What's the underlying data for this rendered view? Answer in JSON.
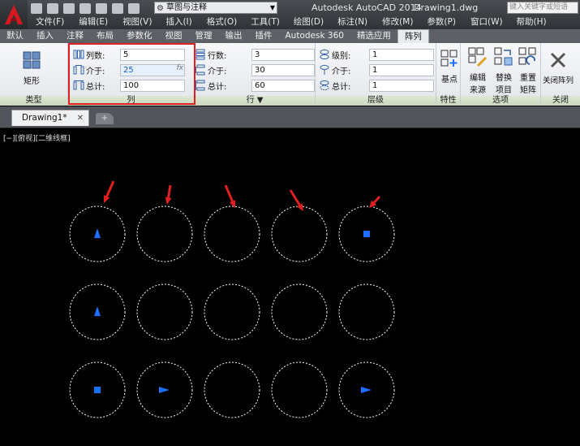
{
  "titlebar": {
    "workspace": "草图与注释",
    "app_title": "Autodesk AutoCAD 2014",
    "doc_title": "Drawing1.dwg",
    "search_placeholder": "键入关键字或短语"
  },
  "menu": [
    "文件(F)",
    "编辑(E)",
    "视图(V)",
    "插入(I)",
    "格式(O)",
    "工具(T)",
    "绘图(D)",
    "标注(N)",
    "修改(M)",
    "参数(P)",
    "窗口(W)",
    "帮助(H)"
  ],
  "ribbon_tabs": [
    "默认",
    "插入",
    "注释",
    "布局",
    "参数化",
    "视图",
    "管理",
    "输出",
    "插件",
    "Autodesk 360",
    "精选应用",
    "阵列"
  ],
  "active_tab": "阵列",
  "ribbon": {
    "type_panel": {
      "button": "矩形",
      "title": "类型"
    },
    "columns_panel": {
      "title": "列",
      "rows": [
        {
          "label": "列数:",
          "value": "5"
        },
        {
          "label": "介于:",
          "value": "25"
        },
        {
          "label": "总计:",
          "value": "100"
        }
      ],
      "fx": "fx"
    },
    "rows_panel": {
      "title": "行 ▼",
      "rows": [
        {
          "label": "行数:",
          "value": "3"
        },
        {
          "label": "介于:",
          "value": "30"
        },
        {
          "label": "总计:",
          "value": "60"
        }
      ]
    },
    "levels_panel": {
      "title": "层级",
      "rows": [
        {
          "label": "级别:",
          "value": "1"
        },
        {
          "label": "介于:",
          "value": "1"
        },
        {
          "label": "总计:",
          "value": "1"
        }
      ]
    },
    "props_panel": {
      "title": "特性",
      "base_point": "基点"
    },
    "options_panel": {
      "title": "选项",
      "edit_source": [
        "编辑",
        "来源"
      ],
      "replace_item": [
        "替换",
        "项目"
      ],
      "reset_matrix": [
        "重置",
        "矩阵"
      ]
    },
    "close_panel": {
      "title": "关闭",
      "close_array": "关闭阵列"
    }
  },
  "doc_tab": "Drawing1*",
  "viewport": {
    "label": "[−][俯视][二维线框]",
    "grid_cols": 5,
    "grid_rows": 3,
    "markers": [
      {
        "row": 0,
        "col": 0,
        "shape": "triangle-up"
      },
      {
        "row": 0,
        "col": 4,
        "shape": "square"
      },
      {
        "row": 1,
        "col": 0,
        "shape": "triangle-up"
      },
      {
        "row": 2,
        "col": 0,
        "shape": "square"
      },
      {
        "row": 2,
        "col": 1,
        "shape": "triangle-right"
      },
      {
        "row": 2,
        "col": 4,
        "shape": "triangle-right"
      }
    ],
    "colors": {
      "circle": "#ffffff",
      "marker": "#1e6fff",
      "arrow": "#e02020"
    }
  }
}
